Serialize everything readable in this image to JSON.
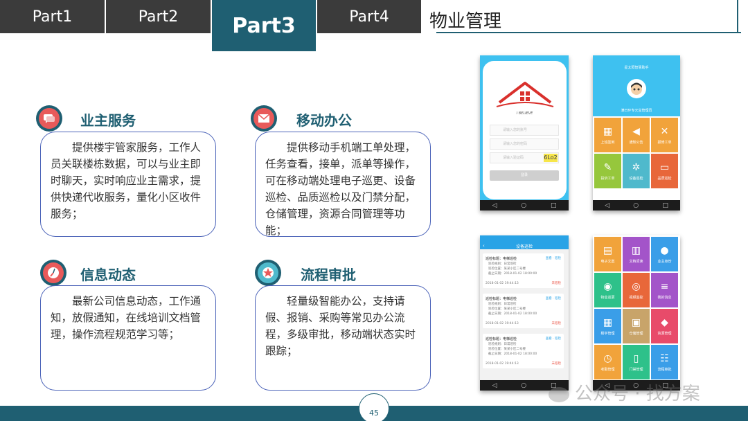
{
  "tabs": [
    {
      "label": "Part1"
    },
    {
      "label": "Part2"
    },
    {
      "label": "Part3"
    },
    {
      "label": "Part4"
    }
  ],
  "page_title": "物业管理",
  "features": [
    {
      "title": "业主服务",
      "text": "提供楼宇管家服务，工作人员关联楼栋数据，可以与业主即时聊天，实时响应业主需求，提供快递代收服务，量化小区收件服务；"
    },
    {
      "title": "移动办公",
      "text": "提供移动手机端工单处理，任务查看，接单，派单等操作，可在移动端处理电子巡更、设备巡检、品质巡检以及门禁分配，仓储管理，资源合同管理等功能；"
    },
    {
      "title": "信息动态",
      "text": "最新公司信息动态，工作通知，放假通知，在线培训文档管理，操作流程规范学习等；"
    },
    {
      "title": "流程审批",
      "text": "轻量级智能办公，支持请假、报销、采购等常见办公流程，多级审批，移动端状态实时跟踪；"
    }
  ],
  "phone_login": {
    "logo_text": "I BELIEVE",
    "fields": [
      "请输入您的账号",
      "请输入您的密码",
      "请输入验证码"
    ],
    "captcha": "6Lo2",
    "button": "登录"
  },
  "phone_menu": {
    "header": "星太阳智慧助手",
    "subtitle": "满日环专元宝管理员",
    "tiles": [
      {
        "label": "上班签到",
        "color": "#f1a33b",
        "glyph": "▦"
      },
      {
        "label": "通知公告",
        "color": "#f1a33b",
        "glyph": "◀"
      },
      {
        "label": "报修工单",
        "color": "#f1a33b",
        "glyph": "✕"
      },
      {
        "label": "投诉工单",
        "color": "#96c73c",
        "glyph": "✎"
      },
      {
        "label": "设备巡检",
        "color": "#4fb9cc",
        "glyph": "✲"
      },
      {
        "label": "品质巡检",
        "color": "#e8673a",
        "glyph": "▭"
      }
    ]
  },
  "phone_list": {
    "header": "设备巡检",
    "cards": [
      {
        "title": "巡检标题：电梯巡检",
        "link": "查看 · 巡检",
        "lines": [
          "巡检规则：日常巡检",
          "巡检位置：某某小区二号楼",
          "截止日期：2018-01-02 18:00:00"
        ],
        "date": "2018-01-02 19:44:13",
        "status": "未巡检"
      },
      {
        "title": "巡检标题：电梯巡检",
        "link": "查看 · 巡检",
        "lines": [
          "巡检规则：日常巡检",
          "巡检位置：某某小区二号楼",
          "截止日期：2018-01-02 18:00:00"
        ],
        "date": "2018-01-02 19:44:13",
        "status": "未巡检"
      },
      {
        "title": "巡检标题：电梯巡检",
        "link": "查看 · 巡检",
        "lines": [
          "巡检规则：日常巡检",
          "巡检位置：某某小区二号楼",
          "截止日期：2018-01-02 18:00:00"
        ],
        "date": "2018-01-02 19:44:13",
        "status": "未巡检"
      }
    ]
  },
  "phone_grid": {
    "tiles": [
      {
        "label": "电子文案",
        "color": "#f1a33b",
        "glyph": "▤"
      },
      {
        "label": "文档须读",
        "color": "#a354c9",
        "glyph": "▥"
      },
      {
        "label": "业主身份",
        "color": "#3a9ee8",
        "glyph": "●"
      },
      {
        "label": "物业巡更",
        "color": "#2ec18a",
        "glyph": "◉"
      },
      {
        "label": "视频监控",
        "color": "#e8673a",
        "glyph": "◎"
      },
      {
        "label": "我的消息",
        "color": "#a354c9",
        "glyph": "≡"
      },
      {
        "label": "楼宇管理",
        "color": "#3a9ee8",
        "glyph": "▦"
      },
      {
        "label": "仓储管理",
        "color": "#c8a46a",
        "glyph": "▣"
      },
      {
        "label": "资源管理",
        "color": "#e84b6a",
        "glyph": "◆"
      },
      {
        "label": "考勤管理",
        "color": "#f1a33b",
        "glyph": "◷"
      },
      {
        "label": "门禁管理",
        "color": "#2ec18a",
        "glyph": "▯"
      },
      {
        "label": "流程审批",
        "color": "#3a9ee8",
        "glyph": "☷"
      }
    ]
  },
  "page_number": "45",
  "watermark": "公众号 · 找方案",
  "colors": {
    "primary": "#1f5f72",
    "tab_dark": "#3b3b3b",
    "box_border": "#4a62b8",
    "icon_red": "#e85a5a"
  }
}
